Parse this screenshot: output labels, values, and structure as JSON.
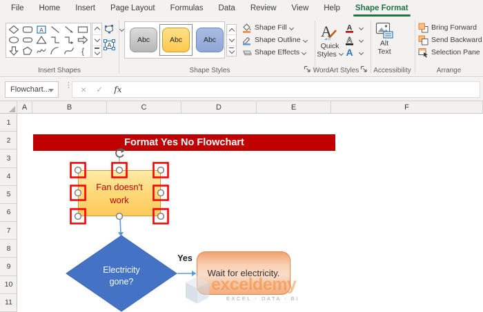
{
  "ribbon": {
    "tabs": [
      {
        "label": "File"
      },
      {
        "label": "Home"
      },
      {
        "label": "Insert"
      },
      {
        "label": "Page Layout"
      },
      {
        "label": "Formulas"
      },
      {
        "label": "Data"
      },
      {
        "label": "Review"
      },
      {
        "label": "View"
      },
      {
        "label": "Help"
      },
      {
        "label": "Shape Format",
        "active": true
      }
    ],
    "insert_shapes": {
      "label": "Insert Shapes",
      "gallery_icons": [
        "diamond-shape-icon",
        "rounded-rectangle-icon",
        "text-box-shape-icon",
        "line-icon",
        "line-arrow-icon",
        "rectangle-icon",
        "oval-icon",
        "rounded-rectangle-flat-icon",
        "triangle-icon",
        "elbow-connector-icon",
        "elbow-arrow-connector-icon",
        "right-block-arrow-icon",
        "down-block-arrow-icon",
        "freeform-shape-icon",
        "scribble-icon",
        "arc-icon",
        "curve-icon",
        "left-brace-icon"
      ]
    },
    "shape_styles": {
      "label": "Shape Styles",
      "chips": [
        {
          "label": "Abc",
          "variant": "gray",
          "selected": false
        },
        {
          "label": "Abc",
          "variant": "gold",
          "selected": true
        },
        {
          "label": "Abc",
          "variant": "blue",
          "selected": false
        }
      ],
      "menu_buttons": [
        {
          "label": "Shape Fill"
        },
        {
          "label": "Shape Outline"
        },
        {
          "label": "Shape Effects"
        }
      ]
    },
    "wordart_styles": {
      "label": "WordArt Styles",
      "quick_styles": {
        "line1": "Quick",
        "line2": "Styles"
      }
    },
    "accessibility": {
      "label": "Accessibility",
      "alt_text": {
        "line1": "Alt",
        "line2": "Text"
      }
    },
    "arrange": {
      "label": "Arrange",
      "items": [
        {
          "label": "Bring Forward"
        },
        {
          "label": "Send Backward"
        },
        {
          "label": "Selection Pane"
        }
      ]
    }
  },
  "formula_bar": {
    "name_box_value": "Flowchart...",
    "fx_label": "fx",
    "cancel_glyph": "×",
    "enter_glyph": "✓"
  },
  "sheet": {
    "columns": [
      "A",
      "B",
      "C",
      "D",
      "E",
      "F"
    ],
    "rows": [
      "1",
      "2",
      "3",
      "4",
      "5",
      "6",
      "7",
      "8",
      "9",
      "10",
      "11"
    ]
  },
  "flowchart": {
    "banner": {
      "text": "Format Yes No Flowchart"
    },
    "process": {
      "line1": "Fan doesn't",
      "line2": "work"
    },
    "decision": {
      "line1": "Electricity",
      "line2": "gone?"
    },
    "result": {
      "text": "Wait for electricity."
    },
    "branch_yes": {
      "text": "Yes"
    },
    "watermark": {
      "brand": "exceldemy",
      "tagline": "EXCEL - DATA - BI"
    }
  },
  "colors": {
    "excel_green": "#217346",
    "banner_red": "#C00000",
    "process_fill_top": "#FFE9A8",
    "process_fill_bottom": "#FDC95B",
    "process_text_red": "#C00000",
    "decision_blue": "#4472C4",
    "connector_blue": "#5B9BD5",
    "result_orange_border": "#E8824A",
    "result_orange_fill": "#F9D0B2",
    "selection_annotation_red": "#FF0000",
    "watermark_orange": "#F28C38"
  }
}
